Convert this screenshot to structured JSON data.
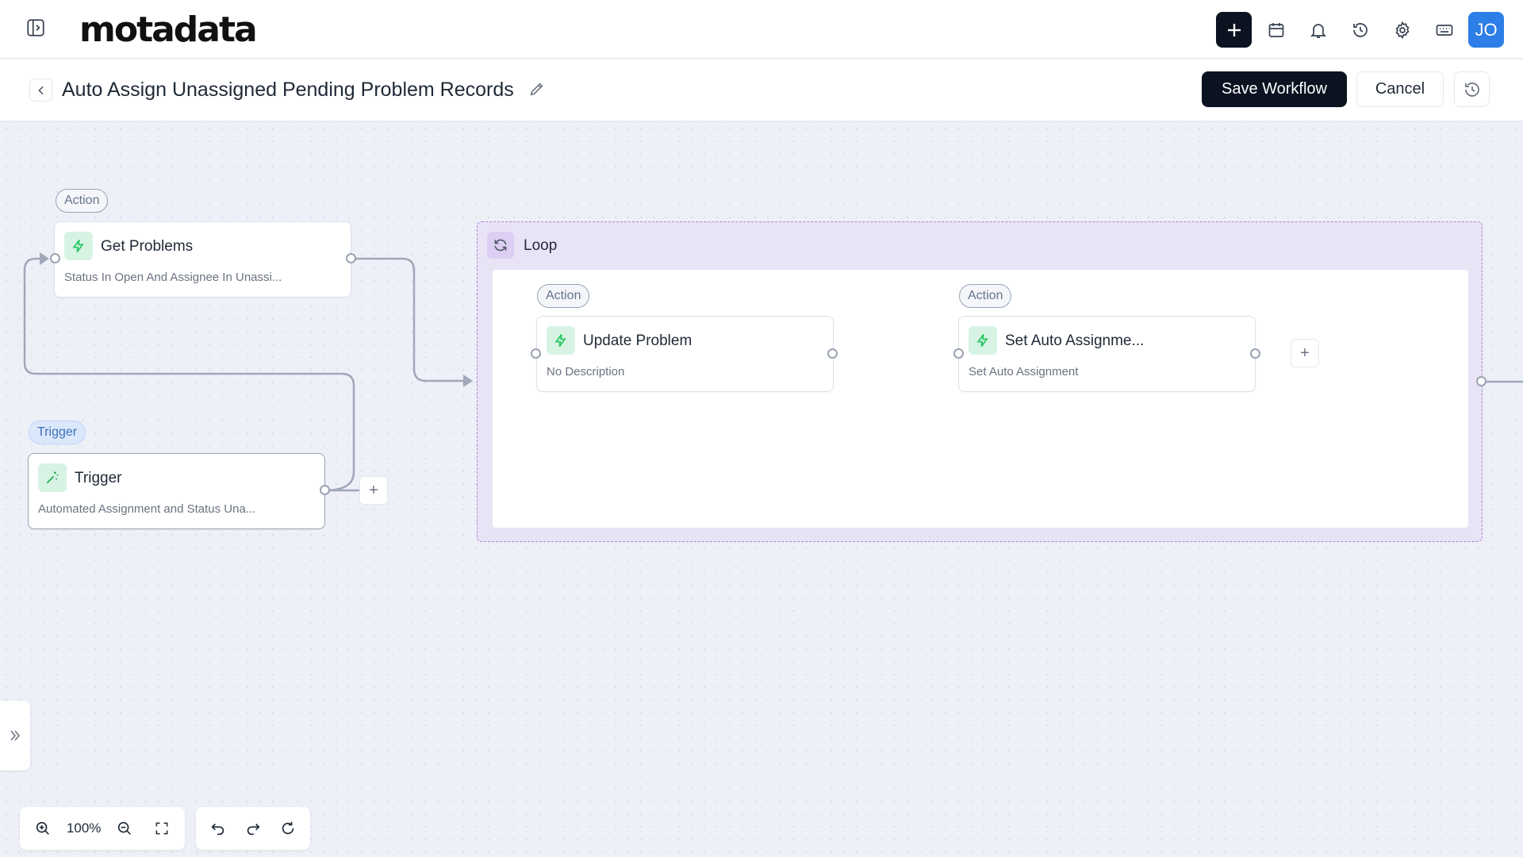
{
  "app": {
    "logo": "motadata",
    "avatar_initials": "JO"
  },
  "header": {
    "title": "Auto Assign Unassigned Pending Problem Records",
    "save_label": "Save Workflow",
    "cancel_label": "Cancel"
  },
  "nodes": {
    "get_problems": {
      "tag": "Action",
      "title": "Get Problems",
      "desc": "Status In Open And Assignee In Unassi..."
    },
    "trigger": {
      "tag": "Trigger",
      "title": "Trigger",
      "desc": "Automated Assignment and Status Una..."
    },
    "loop": {
      "label": "Loop"
    },
    "update_problem": {
      "tag": "Action",
      "title": "Update Problem",
      "desc": "No Description"
    },
    "set_auto": {
      "tag": "Action",
      "title": "Set Auto Assignme...",
      "desc": "Set Auto Assignment"
    }
  },
  "toolbar": {
    "zoom_level": "100%",
    "plus": "+"
  },
  "colors": {
    "accent_dark": "#0b1220",
    "avatar_blue": "#2d7ee6",
    "action_icon_green": "#22c55e",
    "loop_purple": "#e9e3f6"
  },
  "icons": [
    "sidebar-toggle-icon",
    "plus-icon",
    "calendar-icon",
    "bell-icon",
    "history-icon",
    "gear-icon",
    "keyboard-icon",
    "chevron-left-icon",
    "pencil-icon",
    "restore-icon",
    "bolt-icon",
    "magic-wand-icon",
    "loop-icon",
    "chevrons-right-icon",
    "zoom-in-icon",
    "zoom-out-icon",
    "fullscreen-icon",
    "undo-icon",
    "redo-icon",
    "refresh-icon"
  ]
}
